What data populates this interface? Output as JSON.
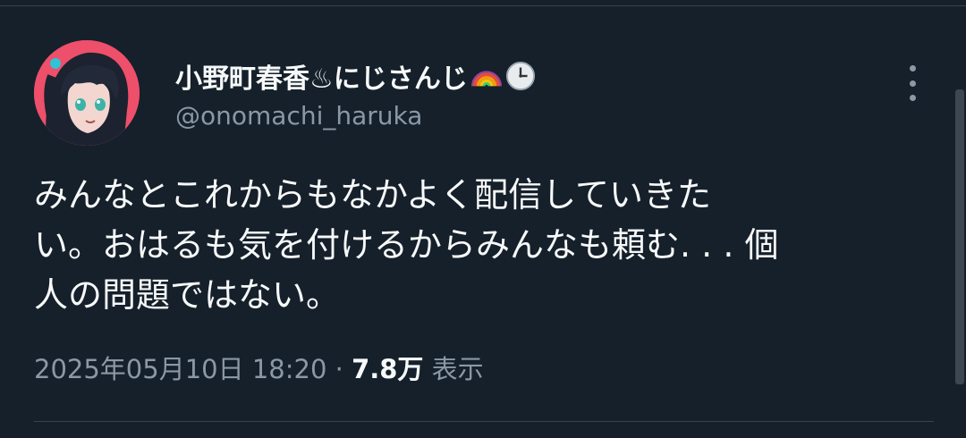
{
  "tweet": {
    "display_name": "小野町春香♨にじさんじ",
    "badges": [
      "rainbow-emoji",
      "clock-emoji"
    ],
    "handle": "@onomachi_haruka",
    "body": "みんなとこれからもなかよく配信していきた\nい。おはるも気を付けるからみんなも頼む. . . 個\n人の問題ではない。",
    "timestamp": "2025年05月10日 18:20",
    "separator": " · ",
    "views_count": "7.8万",
    "views_label": " 表示"
  },
  "colors": {
    "background": "#15202b",
    "text_primary": "#f7f9f9",
    "text_secondary": "#8b98a5",
    "divider": "#38444d",
    "avatar_bg": "#ee4f6a"
  }
}
